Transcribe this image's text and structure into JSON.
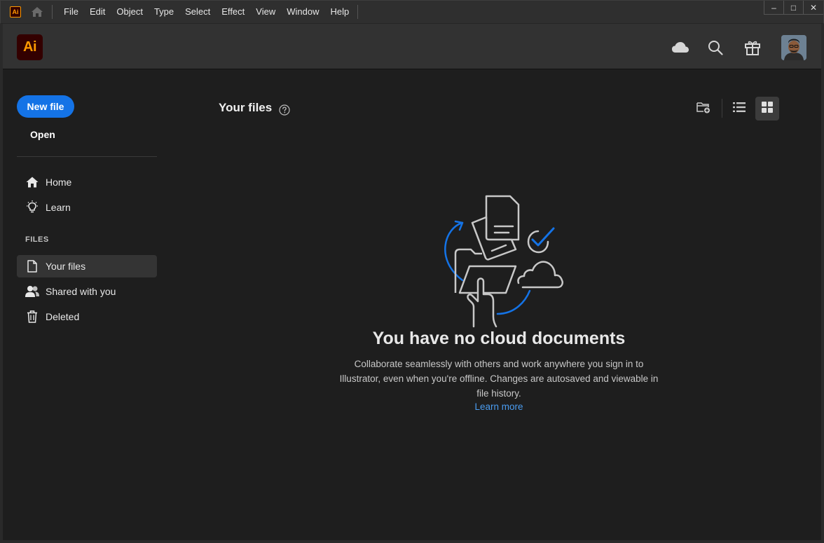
{
  "menubar": {
    "app_logo": "Ai",
    "items": [
      "File",
      "Edit",
      "Object",
      "Type",
      "Select",
      "Effect",
      "View",
      "Window",
      "Help"
    ],
    "window_controls": {
      "minimize": "–",
      "maximize": "□",
      "close": "✕"
    }
  },
  "header": {
    "logo_text": "Ai",
    "icons": [
      "cloud-icon",
      "search-icon",
      "gift-icon",
      "avatar"
    ]
  },
  "sidebar": {
    "new_file_label": "New file",
    "open_label": "Open",
    "nav": [
      {
        "label": "Home",
        "icon": "home-icon"
      },
      {
        "label": "Learn",
        "icon": "lightbulb-icon"
      }
    ],
    "files_heading": "FILES",
    "files_nav": [
      {
        "label": "Your files",
        "icon": "file-icon",
        "active": true
      },
      {
        "label": "Shared with you",
        "icon": "people-icon",
        "active": false
      },
      {
        "label": "Deleted",
        "icon": "trash-icon",
        "active": false
      }
    ]
  },
  "main": {
    "title": "Your files",
    "view_tools": [
      "new-folder-icon",
      "list-view-icon",
      "grid-view-icon"
    ],
    "active_view": "grid",
    "empty_state": {
      "title": "You have no cloud documents",
      "description": "Collaborate seamlessly with others and work anywhere you sign in to Illustrator, even when you're offline. Changes are autosaved and viewable in file history.",
      "link": "Learn more"
    }
  },
  "colors": {
    "accent": "#1473e6",
    "link": "#4a9cf0",
    "logo_bg": "#330000",
    "logo_fg": "#ff9a00"
  }
}
